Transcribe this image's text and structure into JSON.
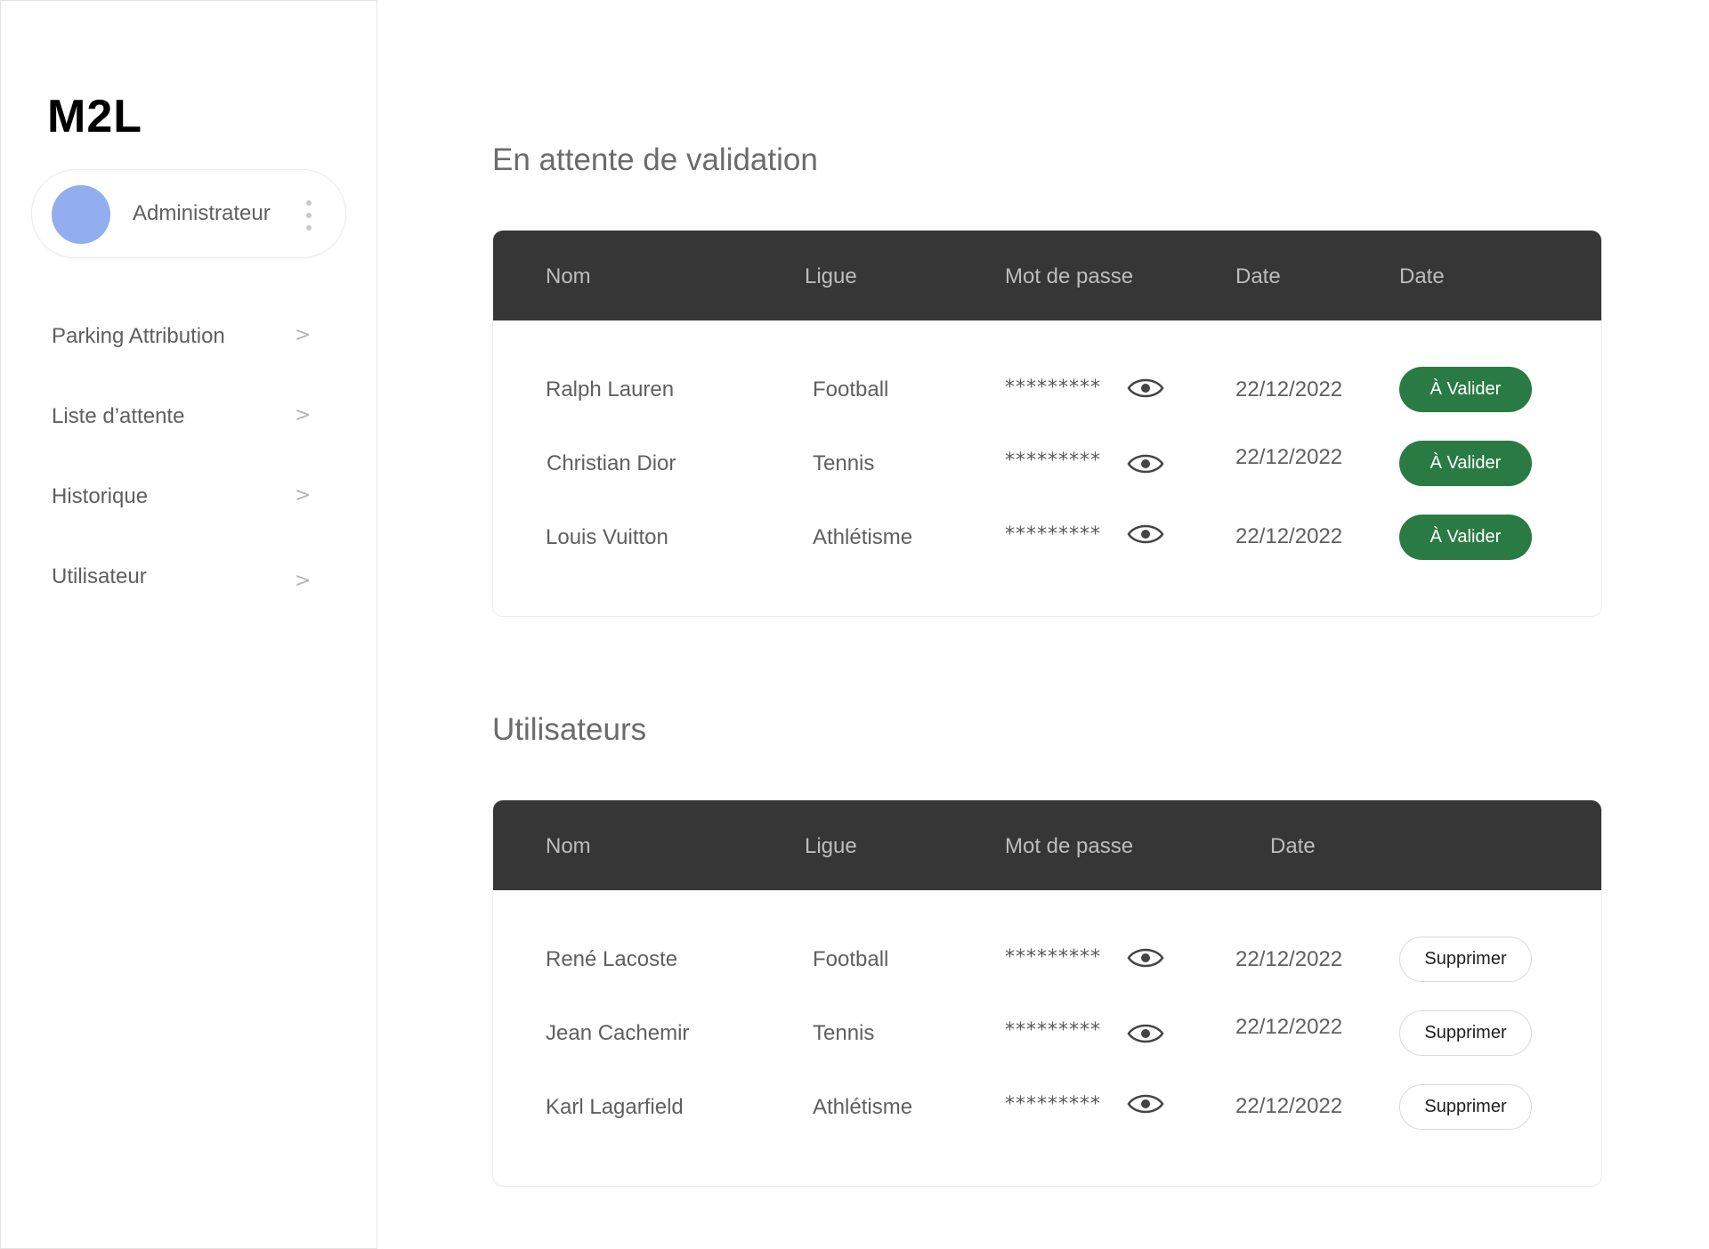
{
  "app": {
    "logo": "M2L"
  },
  "profile": {
    "name": "Administrateur",
    "avatar_color": "#93aeee"
  },
  "nav": {
    "items": [
      {
        "label": "Parking Attribution",
        "icon": "chevron-right-icon"
      },
      {
        "label": "Liste d’attente",
        "icon": "chevron-right-icon"
      },
      {
        "label": "Historique",
        "icon": "chevron-right-icon"
      },
      {
        "label": "Utilisateur",
        "icon": "chevron-right-icon"
      }
    ],
    "chevron": ">"
  },
  "pending": {
    "title": "En attente de validation",
    "columns": [
      "Nom",
      "Ligue",
      "Mot de passe",
      "Date",
      "Date"
    ],
    "rows": [
      {
        "name": "Ralph Lauren",
        "league": "Football",
        "password": "*********",
        "date": "22/12/2022",
        "action": "À Valider"
      },
      {
        "name": "Christian Dior",
        "league": "Tennis",
        "password": "*********",
        "date": "22/12/2022",
        "action": "À Valider"
      },
      {
        "name": "Louis Vuitton",
        "league": "Athlétisme",
        "password": "*********",
        "date": "22/12/2022",
        "action": "À Valider"
      }
    ]
  },
  "users": {
    "title": "Utilisateurs",
    "columns": [
      "Nom",
      "Ligue",
      "Mot de passe",
      "Date"
    ],
    "rows": [
      {
        "name": "René Lacoste",
        "league": "Football",
        "password": "*********",
        "date": "22/12/2022",
        "action": "Supprimer"
      },
      {
        "name": "Jean Cachemir",
        "league": "Tennis",
        "password": "*********",
        "date": "22/12/2022",
        "action": "Supprimer"
      },
      {
        "name": "Karl Lagarfield",
        "league": "Athlétisme",
        "password": "*********",
        "date": "22/12/2022",
        "action": "Supprimer"
      }
    ]
  },
  "colors": {
    "header_bg": "#363636",
    "validate_button": "#2a7b43",
    "text": "#5f5f5f"
  }
}
